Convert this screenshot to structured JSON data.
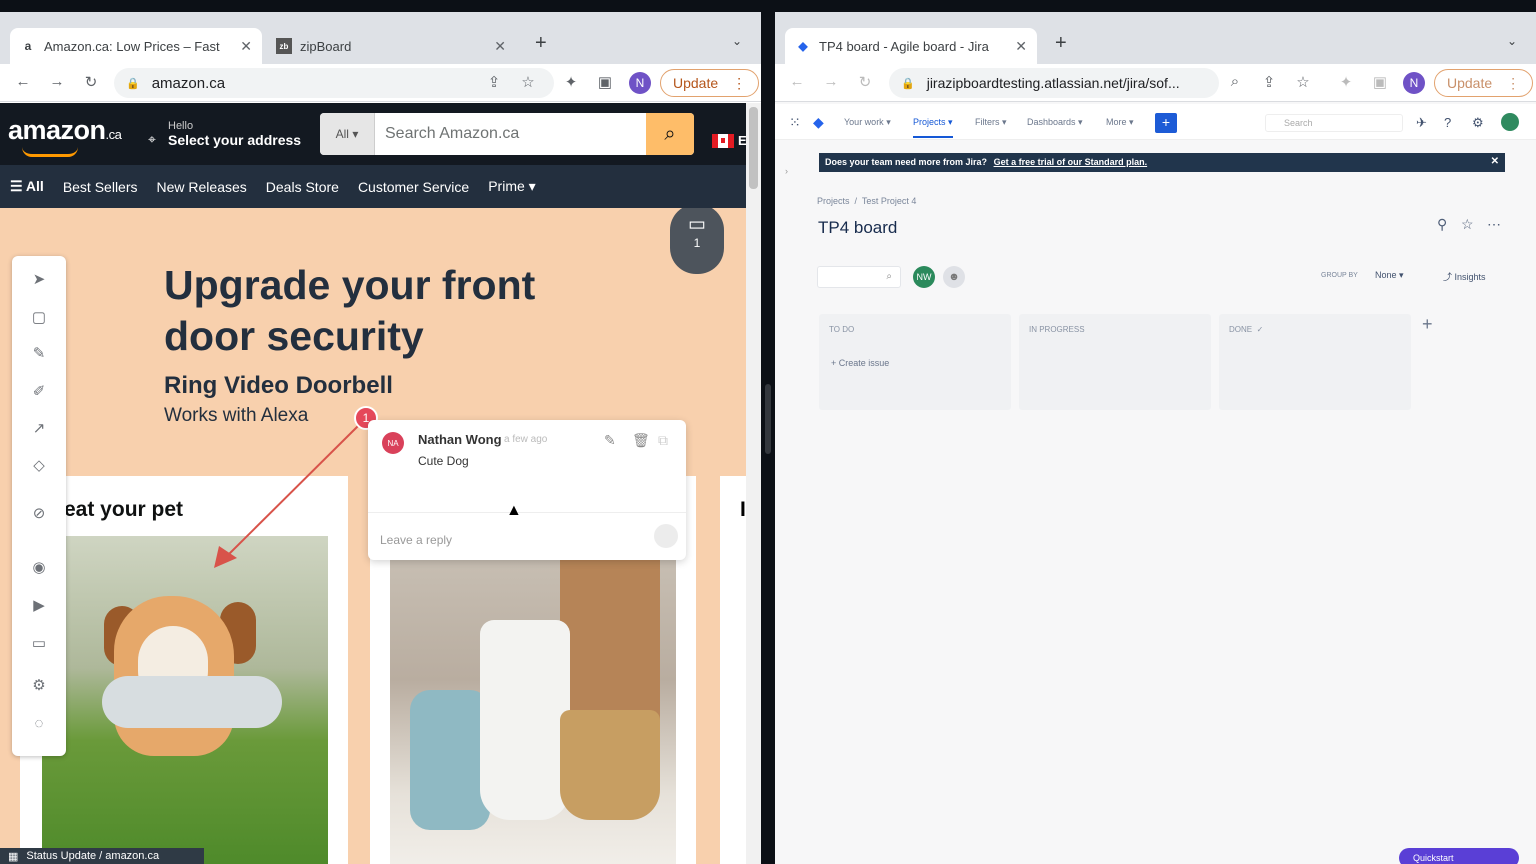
{
  "left_browser": {
    "tabs": [
      {
        "title": "Amazon.ca: Low Prices – Fast",
        "favicon": "a"
      },
      {
        "title": "zipBoard",
        "favicon": "zb"
      }
    ],
    "url": "amazon.ca",
    "profile_initial": "N",
    "update_label": "Update"
  },
  "amazon": {
    "logo": "amazon",
    "logo_suffix": ".ca",
    "deliver_hello": "Hello",
    "deliver_address": "Select your address",
    "search_category": "All",
    "search_placeholder": "Search Amazon.ca",
    "flag_letter": "E",
    "nav": {
      "all": "All",
      "items": [
        "Best Sellers",
        "New Releases",
        "Deals Store",
        "Customer Service",
        "Prime"
      ]
    },
    "hero_title_line1": "Upgrade your front",
    "hero_title_line2": "door security",
    "hero_subtitle": "Ring Video Doorbell",
    "hero_tagline": "Works with Alexa",
    "card1_title": "eat your pet",
    "card3_title": "I"
  },
  "zipboard": {
    "chat_count": "1",
    "marker_number": "1",
    "comment": {
      "avatar": "NA",
      "author": "Nathan Wong",
      "time": "a few ago",
      "text": "Cute Dog",
      "reply_placeholder": "Leave a reply"
    },
    "status_bar": "Status Update / amazon.ca"
  },
  "right_browser": {
    "tabs": [
      {
        "title": "TP4 board - Agile board - Jira"
      }
    ],
    "url": "jirazipboardtesting.atlassian.net/jira/sof...",
    "profile_initial": "N",
    "update_label": "Update"
  },
  "jira": {
    "nav": [
      "Your work",
      "Projects",
      "Filters",
      "Dashboards",
      "More"
    ],
    "search_placeholder": "Search",
    "banner_text": "Does your team need more from Jira?",
    "banner_link": "Get a free trial of our Standard plan.",
    "breadcrumb_projects": "Projects",
    "breadcrumb_project": "Test Project 4",
    "board_title": "TP4 board",
    "avatar_initials": "NW",
    "group_by_label": "GROUP BY",
    "group_by_value": "None",
    "insights_label": "Insights",
    "columns": [
      {
        "name": "TO DO",
        "action": "Create issue"
      },
      {
        "name": "IN PROGRESS",
        "action": ""
      },
      {
        "name": "DONE",
        "action": ""
      }
    ],
    "quickstart_label": "Quickstart"
  }
}
